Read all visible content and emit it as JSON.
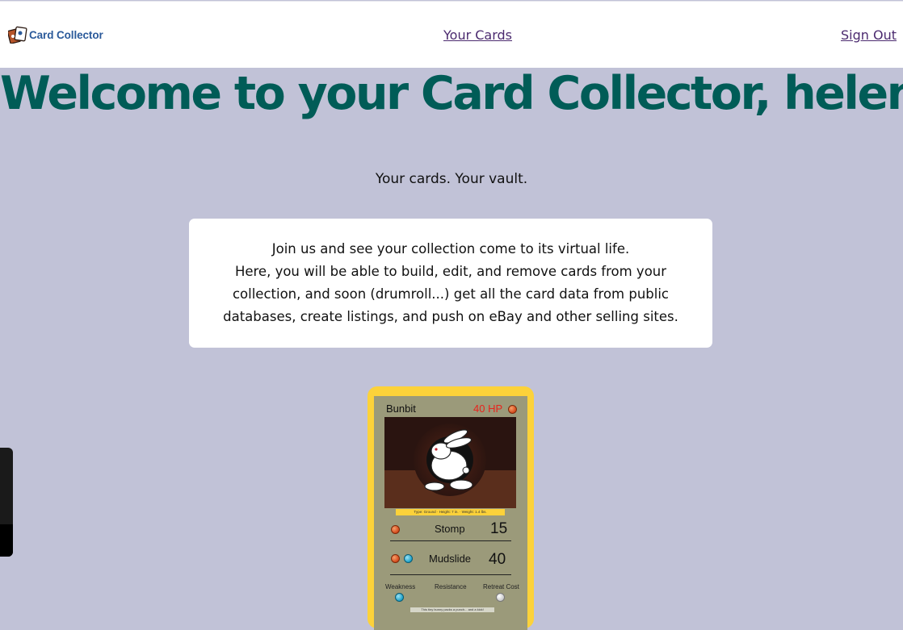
{
  "header": {
    "logo_text": "Card Collector",
    "nav": {
      "cards_label": "Your Cards",
      "signout_label": "Sign Out"
    }
  },
  "main": {
    "welcome": "Welcome to your Card Collector, helen!",
    "tagline": "Your cards. Your vault.",
    "intro_lines": [
      "Join us and see your collection come to its virtual life.",
      "Here, you will be able to build, edit, and remove cards from your",
      "collection, and soon (drumroll...) get all the card data from public",
      "databases, create listings, and push on eBay and other selling sites."
    ]
  },
  "card": {
    "name": "Bunbit",
    "hp": "40 HP",
    "type_line": "Type: Ground · Height: 7 in. · Weight: 1.4 lbs.",
    "attacks": [
      {
        "name": "Stomp",
        "damage": "15"
      },
      {
        "name": "Mudslide",
        "damage": "40"
      }
    ],
    "weakness_label": "Weakness",
    "resistance_label": "Resistance",
    "retreat_label": "Retreat Cost",
    "flavor": "This tiny bunny packs a punch... and a kick!"
  },
  "colors": {
    "background": "#c1c2d7",
    "welcome": "#005c57",
    "link": "#4b2a6f",
    "card_border": "#fcd23a",
    "hp": "#e8231c"
  },
  "icons": [
    "card-collector-logo-icon",
    "fire-energy-icon",
    "water-energy-icon",
    "colorless-energy-icon",
    "rabbit-icon"
  ]
}
